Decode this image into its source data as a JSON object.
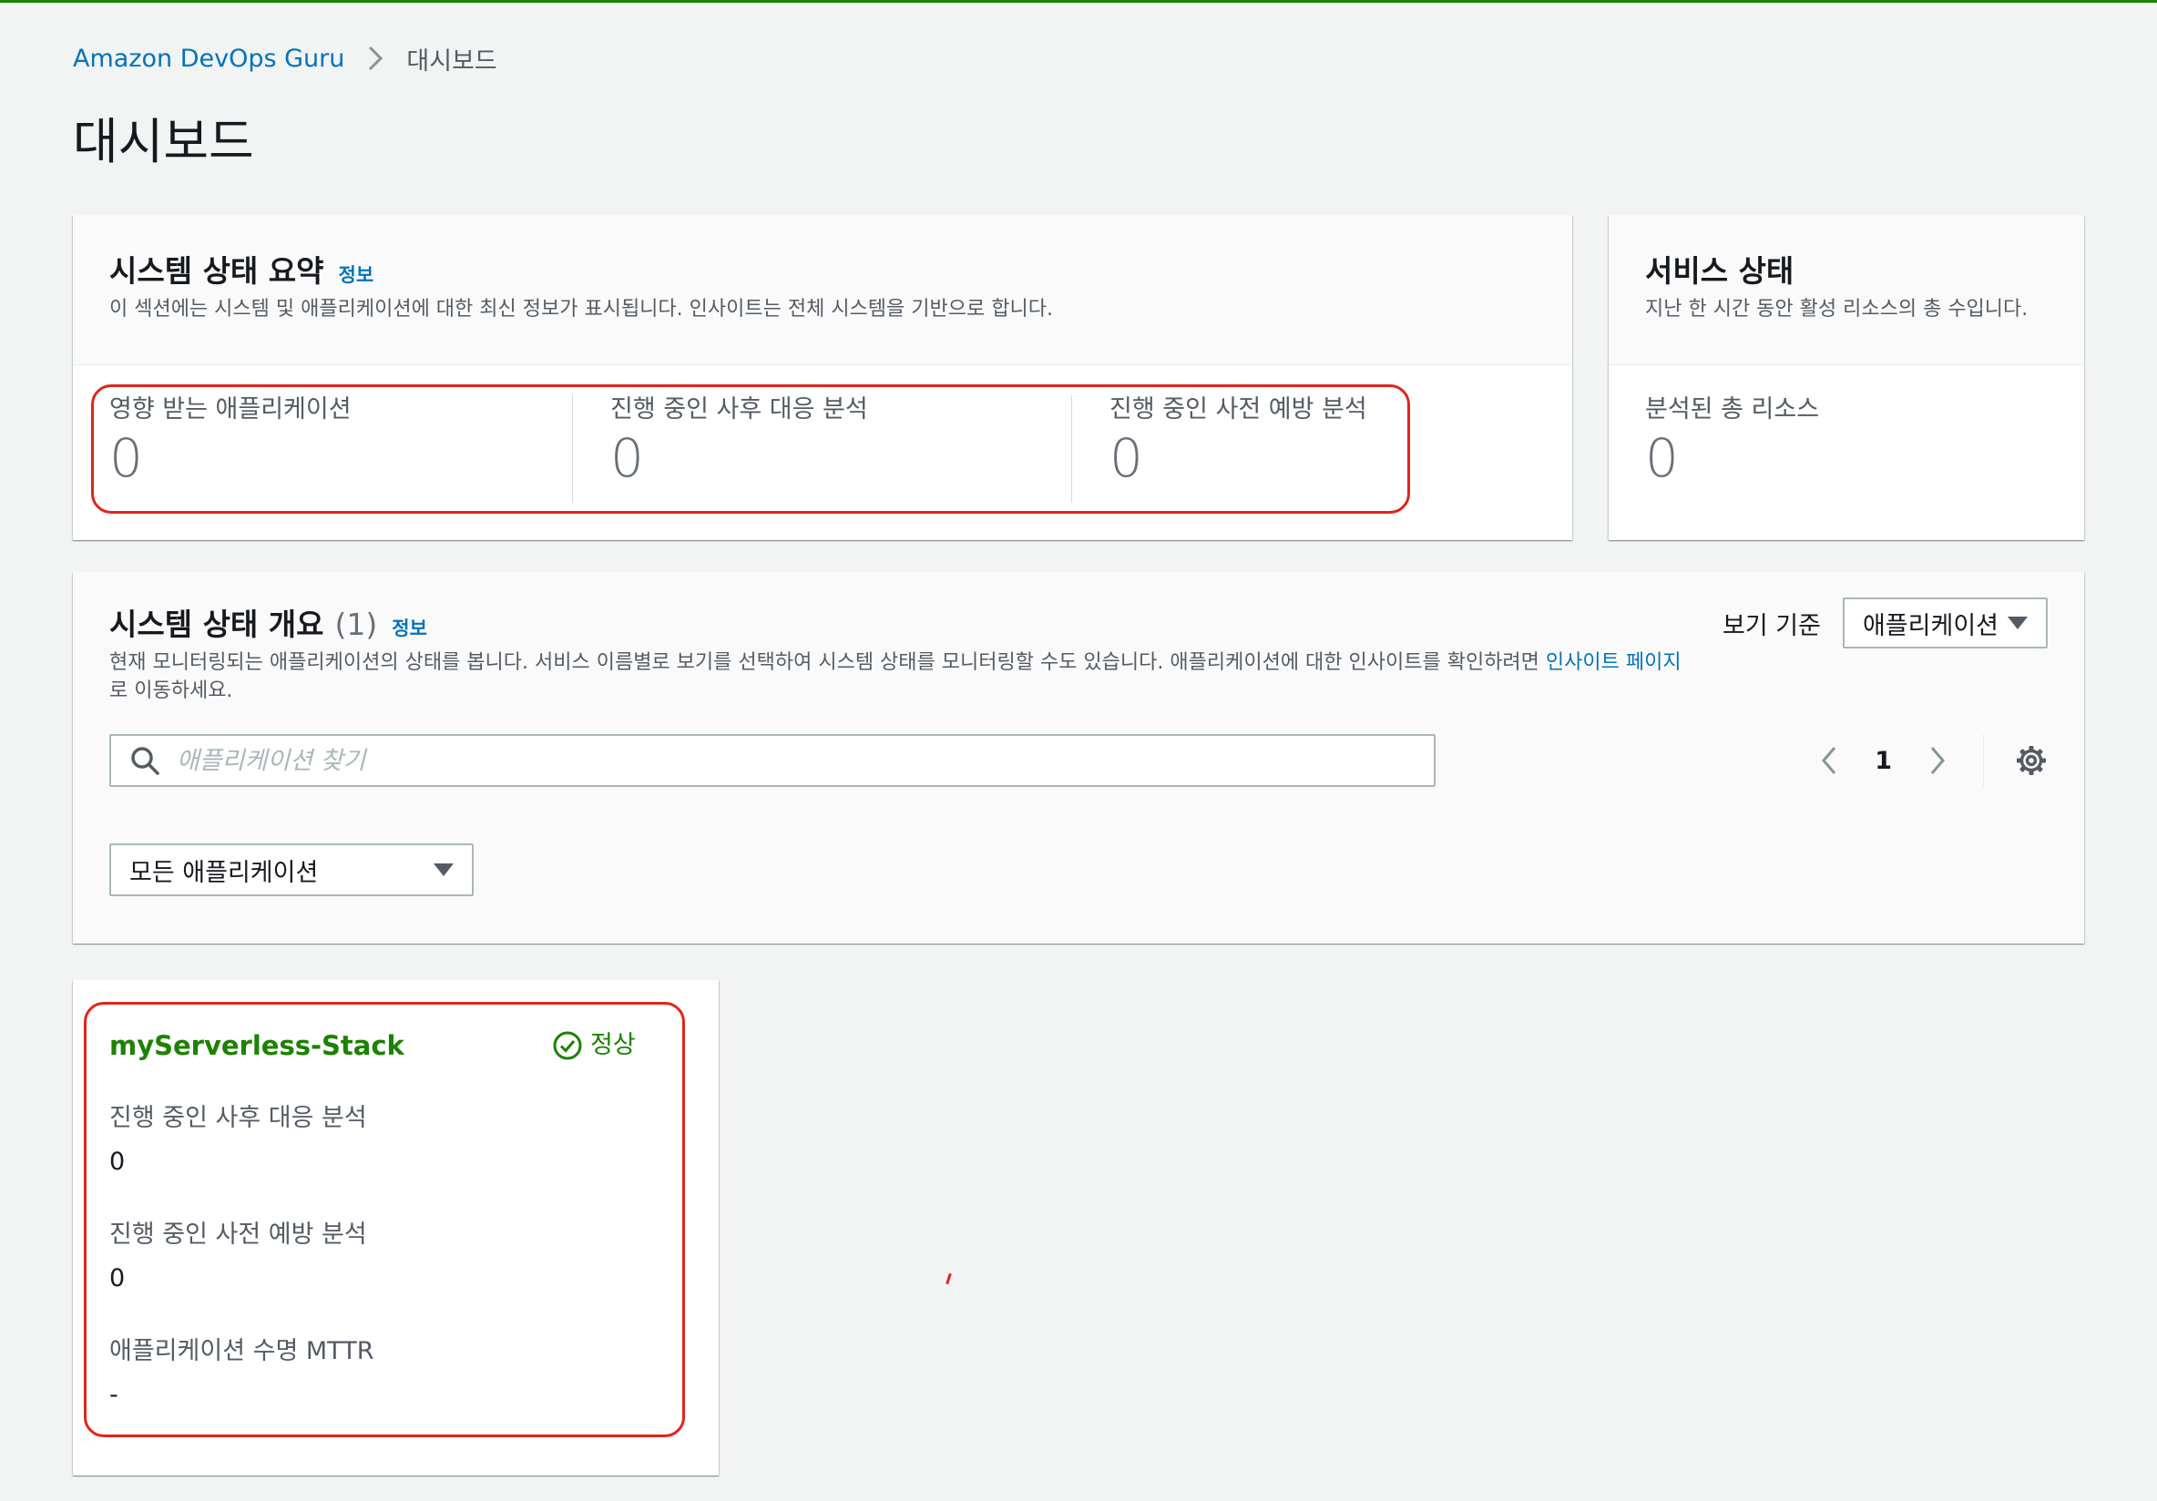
{
  "breadcrumb": {
    "root": "Amazon DevOps Guru",
    "current": "대시보드"
  },
  "page": {
    "title": "대시보드"
  },
  "summary": {
    "title": "시스템 상태 요약",
    "info": "정보",
    "description": "이 섹션에는 시스템 및 애플리케이션에 대한 최신 정보가 표시됩니다. 인사이트는 전체 시스템을 기반으로 합니다.",
    "metrics": [
      {
        "label": "영향 받는 애플리케이션",
        "value": "0"
      },
      {
        "label": "진행 중인 사후 대응 분석",
        "value": "0"
      },
      {
        "label": "진행 중인 사전 예방 분석",
        "value": "0"
      }
    ]
  },
  "service_health": {
    "title": "서비스 상태",
    "description": "지난 한 시간 동안 활성 리소스의 총 수입니다.",
    "metric": {
      "label": "분석된 총 리소스",
      "value": "0"
    }
  },
  "overview": {
    "title": "시스템 상태 개요",
    "count": "(1)",
    "info": "정보",
    "description": "현재 모니터링되는 애플리케이션의 상태를 봅니다. 서비스 이름별로 보기를 선택하여 시스템 상태를 모니터링할 수도 있습니다. 애플리케이션에 대한 인사이트를 확인하려면",
    "description_link": "인사이트 페이지",
    "description_tail": "로 이동하세요.",
    "view_by_label": "보기 기준",
    "view_by_value": "애플리케이션",
    "search_placeholder": "애플리케이션 찾기",
    "page_number": "1",
    "filter_value": "모든 애플리케이션"
  },
  "app_card": {
    "name": "myServerless-Stack",
    "status": "정상",
    "fields": [
      {
        "label": "진행 중인 사후 대응 분석",
        "value": "0"
      },
      {
        "label": "진행 중인 사전 예방 분석",
        "value": "0"
      },
      {
        "label": "애플리케이션 수명 MTTR",
        "value": "-"
      }
    ]
  },
  "colors": {
    "link": "#0073bb",
    "success": "#1d8102",
    "highlight": "#e0251b"
  },
  "icons": [
    "chevron-right-icon",
    "search-icon",
    "chevron-left-icon",
    "gear-icon",
    "caret-down-icon",
    "check-circle-icon"
  ]
}
